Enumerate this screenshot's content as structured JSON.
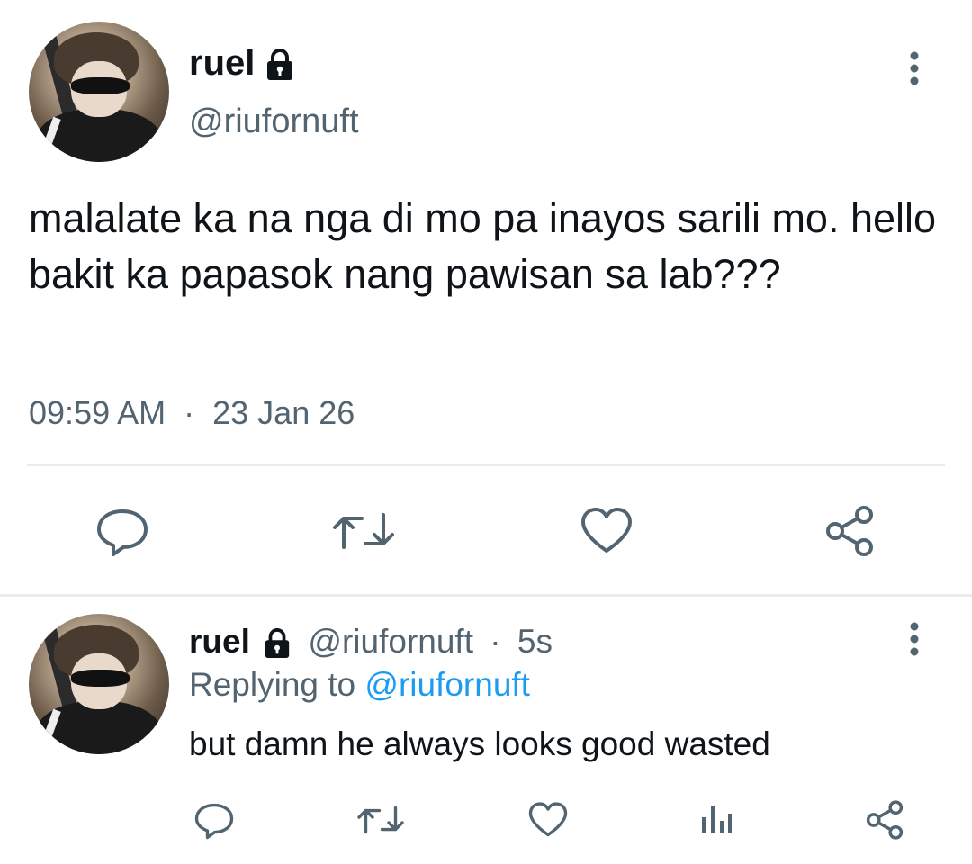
{
  "main_tweet": {
    "display_name": "ruel",
    "handle": "@riufornuft",
    "text": "malalate ka na nga di mo pa inayos sarili mo. hello bakit ka papasok nang pawisan sa lab???",
    "time": "09:59 AM",
    "separator": "·",
    "date": "23 Jan 26",
    "locked": true
  },
  "reply_tweet": {
    "display_name": "ruel",
    "handle": "@riufornuft",
    "separator": "·",
    "age": "5s",
    "replying_label": "Replying to",
    "replying_handle": "@riufornuft",
    "text": "but damn he always looks good wasted",
    "locked": true
  },
  "icons": {
    "main_actions": [
      "reply-icon",
      "retweet-icon",
      "like-icon",
      "share-icon"
    ],
    "reply_actions": [
      "reply-icon",
      "retweet-icon",
      "like-icon",
      "analytics-icon",
      "share-icon"
    ],
    "more": "more-vertical-icon",
    "lock": "lock-icon"
  },
  "colors": {
    "text": "#0f1419",
    "secondary": "#536471",
    "accent": "#1d9bf0",
    "icon": "#536471",
    "divider": "#e6ecf0"
  }
}
